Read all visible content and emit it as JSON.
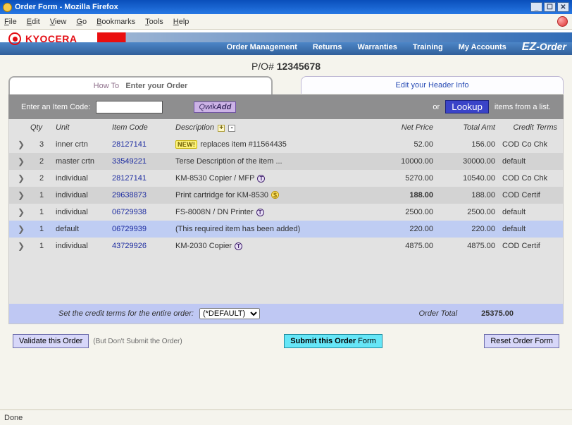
{
  "window": {
    "title": "Order Form - Mozilla Firefox"
  },
  "menubar": {
    "file": "File",
    "edit": "Edit",
    "view": "View",
    "go": "Go",
    "bookmarks": "Bookmarks",
    "tools": "Tools",
    "help": "Help"
  },
  "brand": {
    "kyocera": "KYOCERA",
    "ezorder_em": "EZ",
    "ezorder_rest": "-Order"
  },
  "nav": {
    "order_mgmt": "Order Management",
    "returns": "Returns",
    "warranties": "Warranties",
    "training": "Training",
    "accounts": "My Accounts"
  },
  "po": {
    "label": "P/O# ",
    "number": "12345678"
  },
  "tabs": {
    "howto_label": "How To",
    "order_label": "Enter your Order",
    "edit_label": "Edit your Header Info"
  },
  "actionbar": {
    "prompt": "Enter an Item Code:",
    "qwikadd_pre": "Qwik",
    "qwikadd_bold": "Add",
    "or": "or",
    "lookup": "Lookup",
    "suffix": "items from a list."
  },
  "columns": {
    "qty": "Qty",
    "unit": "Unit",
    "item_code": "Item Code",
    "description": "Description",
    "net_price": "Net Price",
    "total_amt": "Total Amt",
    "credit_terms": "Credit Terms"
  },
  "rows": [
    {
      "qty": "3",
      "unit": "inner crtn",
      "code": "28127141",
      "desc": "replaces item #11564435",
      "net": "52.00",
      "tot": "156.00",
      "terms": "COD Co Chk",
      "badge": "NEW!",
      "sel": false,
      "striped": false
    },
    {
      "qty": "2",
      "unit": "master crtn",
      "code": "33549221",
      "desc": "Terse Description of the item ...",
      "net": "10000.00",
      "tot": "30000.00",
      "terms": "default",
      "badge": "",
      "sel": false,
      "striped": true
    },
    {
      "qty": "2",
      "unit": "individual",
      "code": "28127141",
      "desc": "KM-8530 Copier / MFP",
      "net": "5270.00",
      "tot": "10540.00",
      "terms": "COD Co Chk",
      "badge": "",
      "sel": false,
      "striped": false,
      "t": true
    },
    {
      "qty": "1",
      "unit": "individual",
      "code": "29638873",
      "desc": "Print cartridge for KM-8530",
      "net": "188.00",
      "tot": "188.00",
      "terms": "COD Certif",
      "badge": "",
      "sel": false,
      "striped": true,
      "dollar": true,
      "boldnet": true
    },
    {
      "qty": "1",
      "unit": "individual",
      "code": "06729938",
      "desc": "FS-8008N / DN Printer",
      "net": "2500.00",
      "tot": "2500.00",
      "terms": "default",
      "badge": "",
      "sel": false,
      "striped": false,
      "t": true
    },
    {
      "qty": "1",
      "unit": "default",
      "code": "06729939",
      "desc": "(This required item has been added)",
      "net": "220.00",
      "tot": "220.00",
      "terms": "default",
      "badge": "",
      "sel": true,
      "striped": false
    },
    {
      "qty": "1",
      "unit": "individual",
      "code": "43729926",
      "desc": "KM-2030 Copier",
      "net": "4875.00",
      "tot": "4875.00",
      "terms": "COD Certif",
      "badge": "",
      "sel": false,
      "striped": false,
      "t": true
    }
  ],
  "footer": {
    "set_terms_label": "Set the credit terms for the entire order:",
    "terms_value": "(*DEFAULT)",
    "order_total_label": "Order Total",
    "order_total_value": "25375.00"
  },
  "buttons": {
    "validate": "Validate this Order",
    "validate_note": "(But Don't Submit the Order)",
    "submit_bold": "Submit this Order",
    "submit_rest": " Form",
    "reset": "Reset Order Form"
  },
  "statusbar": {
    "text": "Done"
  }
}
